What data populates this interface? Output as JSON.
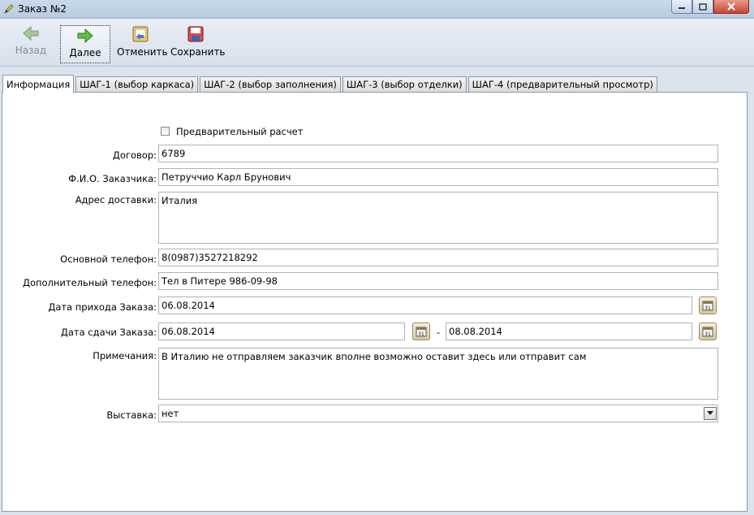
{
  "window": {
    "title": "Заказ №2"
  },
  "toolbar": {
    "back": "Назад",
    "next": "Далее",
    "cancel": "Отменить",
    "save": "Сохранить"
  },
  "tabs": [
    "Информация",
    "ШАГ-1 (выбор каркаса)",
    "ШАГ-2 (выбор заполнения)",
    "ШАГ-3 (выбор отделки)",
    "ШАГ-4 (предварительный просмотр)"
  ],
  "form": {
    "preliminary_label": "Предварительный расчет",
    "contract_label": "Договор:",
    "contract_value": "6789",
    "customer_label": "Ф.И.О. Заказчика:",
    "customer_value": "Петруччио Карл Брунович",
    "address_label": "Адрес доставки:",
    "address_value": "Италия",
    "phone_label": "Основной телефон:",
    "phone_value": "8(0987)3527218292",
    "phone2_label": "Дополнительный телефон:",
    "phone2_value": "Тел в Питере 986-09-98",
    "arrival_label": "Дата прихода Заказа:",
    "arrival_value": "06.08.2014",
    "due_label": "Дата сдачи Заказа:",
    "due_from": "06.08.2014",
    "due_sep": "-",
    "due_to": "08.08.2014",
    "notes_label": "Примечания:",
    "notes_value": "В Италию не отправляем заказчик вполне возможно оставит здесь или отправит сам",
    "exhibit_label": "Выставка:",
    "exhibit_value": "нет"
  }
}
